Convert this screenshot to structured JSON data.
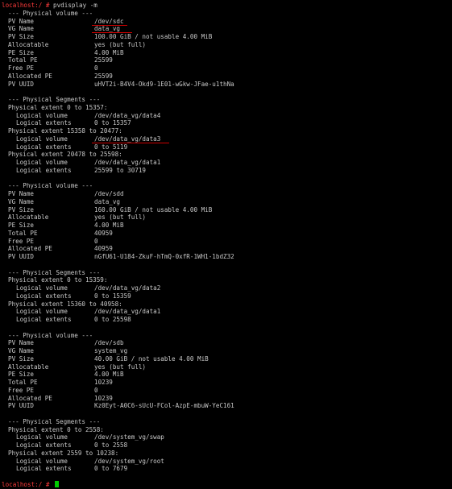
{
  "terminal": {
    "prompt": "localhost:/ #",
    "command": "pvdisplay -m",
    "final_prompt": "localhost:/ #",
    "accent_prompt_color": "#ff3b3b",
    "cursor_color": "#00cc00",
    "annotation_color": "#cc0000"
  },
  "pv1": {
    "header": "--- Physical volume ---",
    "fields": [
      {
        "key": "PV Name",
        "value": "/dev/sdc"
      },
      {
        "key": "VG Name",
        "value": "data_vg"
      },
      {
        "key": "PV Size",
        "value": "100.00 GiB / not usable 4.00 MiB"
      },
      {
        "key": "Allocatable",
        "value": "yes (but full)"
      },
      {
        "key": "PE Size",
        "value": "4.00 MiB"
      },
      {
        "key": "Total PE",
        "value": "25599"
      },
      {
        "key": "Free PE",
        "value": "0"
      },
      {
        "key": "Allocated PE",
        "value": "25599"
      },
      {
        "key": "PV UUID",
        "value": "uHVT2i-B4V4-Okd9-1E01-wGkw-JFae-u1thNa"
      }
    ],
    "segments_header": "--- Physical Segments ---",
    "segments": [
      {
        "extent": "Physical extent 0 to 15357:",
        "lv_key": "Logical volume",
        "lv": "/dev/data_vg/data4",
        "le_key": "Logical extents",
        "le": "0 to 15357"
      },
      {
        "extent": "Physical extent 15358 to 20477:",
        "lv_key": "Logical volume",
        "lv": "/dev/data_vg/data3",
        "le_key": "Logical extents",
        "le": "0 to 5119"
      },
      {
        "extent": "Physical extent 20478 to 25598:",
        "lv_key": "Logical volume",
        "lv": "/dev/data_vg/data1",
        "le_key": "Logical extents",
        "le": "25599 to 30719"
      }
    ]
  },
  "pv2": {
    "header": "--- Physical volume ---",
    "fields": [
      {
        "key": "PV Name",
        "value": "/dev/sdd"
      },
      {
        "key": "VG Name",
        "value": "data_vg"
      },
      {
        "key": "PV Size",
        "value": "160.00 GiB / not usable 4.00 MiB"
      },
      {
        "key": "Allocatable",
        "value": "yes (but full)"
      },
      {
        "key": "PE Size",
        "value": "4.00 MiB"
      },
      {
        "key": "Total PE",
        "value": "40959"
      },
      {
        "key": "Free PE",
        "value": "0"
      },
      {
        "key": "Allocated PE",
        "value": "40959"
      },
      {
        "key": "PV UUID",
        "value": "nGfU61-U184-ZkuF-hTmQ-0xfR-1WH1-1bdZ32"
      }
    ],
    "segments_header": "--- Physical Segments ---",
    "segments": [
      {
        "extent": "Physical extent 0 to 15359:",
        "lv_key": "Logical volume",
        "lv": "/dev/data_vg/data2",
        "le_key": "Logical extents",
        "le": "0 to 15359"
      },
      {
        "extent": "Physical extent 15360 to 40958:",
        "lv_key": "Logical volume",
        "lv": "/dev/data_vg/data1",
        "le_key": "Logical extents",
        "le": "0 to 25598"
      }
    ]
  },
  "pv3": {
    "header": "--- Physical volume ---",
    "fields": [
      {
        "key": "PV Name",
        "value": "/dev/sdb"
      },
      {
        "key": "VG Name",
        "value": "system_vg"
      },
      {
        "key": "PV Size",
        "value": "40.00 GiB / not usable 4.00 MiB"
      },
      {
        "key": "Allocatable",
        "value": "yes (but full)"
      },
      {
        "key": "PE Size",
        "value": "4.00 MiB"
      },
      {
        "key": "Total PE",
        "value": "10239"
      },
      {
        "key": "Free PE",
        "value": "0"
      },
      {
        "key": "Allocated PE",
        "value": "10239"
      },
      {
        "key": "PV UUID",
        "value": "Kz0Eyt-A0C6-sUcU-FCol-AzpE-mbuW-YeC161"
      }
    ],
    "segments_header": "--- Physical Segments ---",
    "segments": [
      {
        "extent": "Physical extent 0 to 2558:",
        "lv_key": "Logical volume",
        "lv": "/dev/system_vg/swap",
        "le_key": "Logical extents",
        "le": "0 to 2558"
      },
      {
        "extent": "Physical extent 2559 to 10238:",
        "lv_key": "Logical volume",
        "lv": "/dev/system_vg/root",
        "le_key": "Logical extents",
        "le": "0 to 7679"
      }
    ]
  }
}
